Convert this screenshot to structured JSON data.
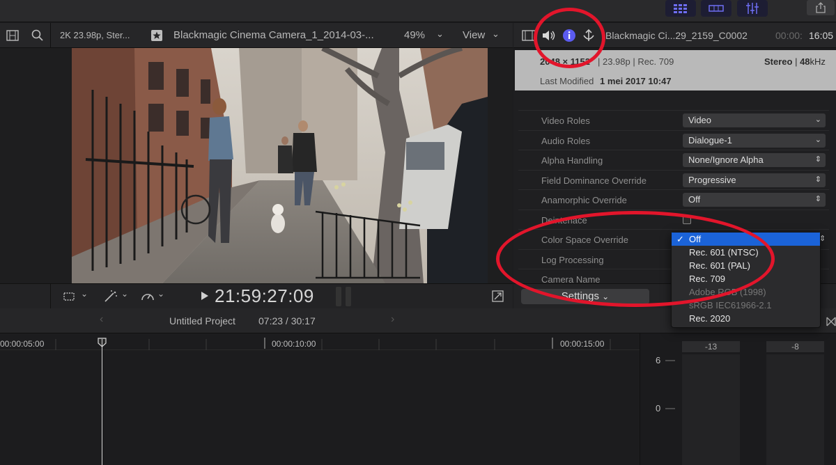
{
  "viewer": {
    "format": "2K 23.98p, Ster...",
    "clip_title": "Blackmagic Cinema Camera_1_2014-03-...",
    "zoom": "49%",
    "view_menu": "View",
    "timecode": "21:59:27:09"
  },
  "inspector": {
    "clip_name": "Blackmagic Ci...29_2159_C0002",
    "timecode_dim": "00:00:",
    "timecode_bright": "16:05",
    "resolution": "2048 × 1152",
    "meta": "| 23.98p | Rec. 709",
    "audio_channels": "Stereo",
    "audio_rate_sep": " | ",
    "audio_rate": "48",
    "audio_unit": "kHz",
    "last_modified_label": "Last Modified",
    "last_modified_value": "1 mei 2017 10:47",
    "settings_label": "Settings",
    "properties": [
      {
        "label": "Video Roles",
        "value": "Video",
        "arrow": "⌄"
      },
      {
        "label": "Audio Roles",
        "value": "Dialogue-1",
        "arrow": "⌄"
      },
      {
        "label": "Alpha Handling",
        "value": "None/Ignore Alpha",
        "arrow": "⇕"
      },
      {
        "label": "Field Dominance Override",
        "value": "Progressive",
        "arrow": "⇕"
      },
      {
        "label": "Anamorphic Override",
        "value": "Off",
        "arrow": "⇕"
      },
      {
        "label": "Deinterlace",
        "value": "",
        "arrow": ""
      },
      {
        "label": "Color Space Override",
        "value": "",
        "arrow": "⇕"
      },
      {
        "label": "Log Processing",
        "value": "",
        "arrow": ""
      },
      {
        "label": "Camera Name",
        "value": "",
        "arrow": ""
      }
    ]
  },
  "dropdown": {
    "items": [
      {
        "label": "Off",
        "selected": true,
        "disabled": false
      },
      {
        "label": "Rec. 601 (NTSC)",
        "selected": false,
        "disabled": false
      },
      {
        "label": "Rec. 601 (PAL)",
        "selected": false,
        "disabled": false
      },
      {
        "label": "Rec. 709",
        "selected": false,
        "disabled": false
      },
      {
        "label": "Adobe RGB (1998)",
        "selected": false,
        "disabled": true
      },
      {
        "label": "sRGB IEC61966-2.1",
        "selected": false,
        "disabled": true
      },
      {
        "label": "Rec. 2020",
        "selected": false,
        "disabled": false
      }
    ]
  },
  "timeline": {
    "project_name": "Untitled Project",
    "duration": "07:23 / 30:17",
    "ruler": [
      "00:00:05:00",
      "00:00:10:00",
      "00:00:15:00"
    ]
  },
  "meters": {
    "peaks": [
      "-13",
      "-8"
    ],
    "scale": [
      "6",
      "0"
    ]
  },
  "colors": {
    "selection": "#1b63d8",
    "annotation": "#e2152b",
    "info_icon": "#5b5bf0"
  }
}
